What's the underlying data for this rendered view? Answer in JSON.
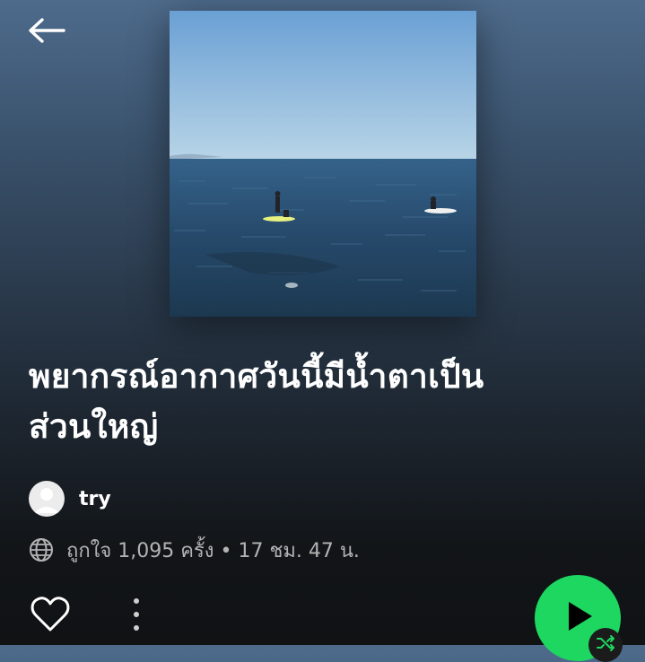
{
  "header": {
    "back_icon": "arrow-left-icon"
  },
  "cover": {
    "description_icon": "playlist-cover-image",
    "colors": {
      "sky_top": "#6fa3d6",
      "sky_bottom": "#b8d4e6",
      "sea_top": "#2f5a7e",
      "sea_bottom": "#1d3a52"
    }
  },
  "playlist": {
    "title": "พยากรณ์อากาศวันนี้มีน้ำตาเป็น\nส่วนใหญ่",
    "owner": {
      "name": "try",
      "avatar_icon": "user-avatar-icon"
    },
    "meta": {
      "visibility_icon": "globe-icon",
      "text": "ถูกใจ 1,095 ครั้ง • 17 ชม. 47 น."
    }
  },
  "actions": {
    "like_icon": "heart-outline-icon",
    "more_icon": "more-vertical-icon",
    "play_icon": "play-icon",
    "shuffle_icon": "shuffle-icon"
  },
  "colors": {
    "accent": "#1ed760",
    "muted_text": "#b3b3b3",
    "background_top": "#4e6b8c",
    "background_bottom": "#101214"
  }
}
